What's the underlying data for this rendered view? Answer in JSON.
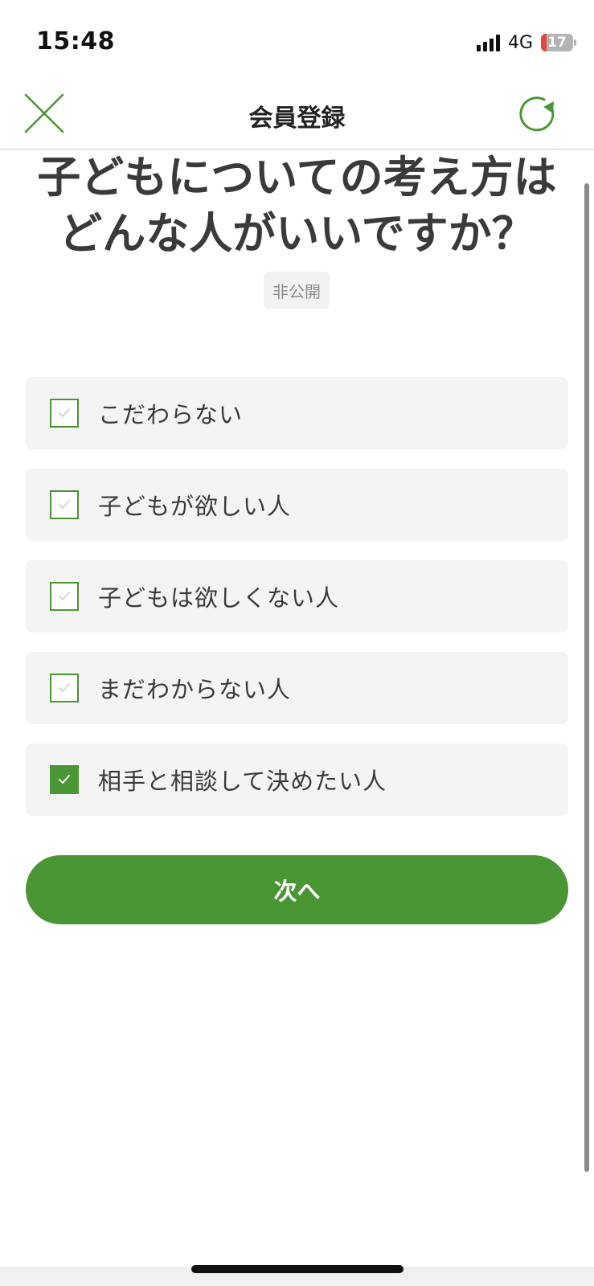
{
  "status_bar": {
    "time": "15:48",
    "network": "4G",
    "battery_level": "17",
    "battery_fraction": 0.17
  },
  "nav": {
    "title": "会員登録",
    "close_icon": "close-icon",
    "refresh_icon": "refresh-icon",
    "accent_color": "#4a9534"
  },
  "question": {
    "title": "子どもについての考え方はどんな人がいいですか？",
    "badge": "非公開"
  },
  "options": [
    {
      "label": "こだわらない",
      "checked": false
    },
    {
      "label": "子どもが欲しい人",
      "checked": false
    },
    {
      "label": "子どもは欲しくない人",
      "checked": false
    },
    {
      "label": "まだわからない人",
      "checked": false
    },
    {
      "label": "相手と相談して決めたい人",
      "checked": true
    }
  ],
  "next_button": {
    "label": "次へ"
  }
}
